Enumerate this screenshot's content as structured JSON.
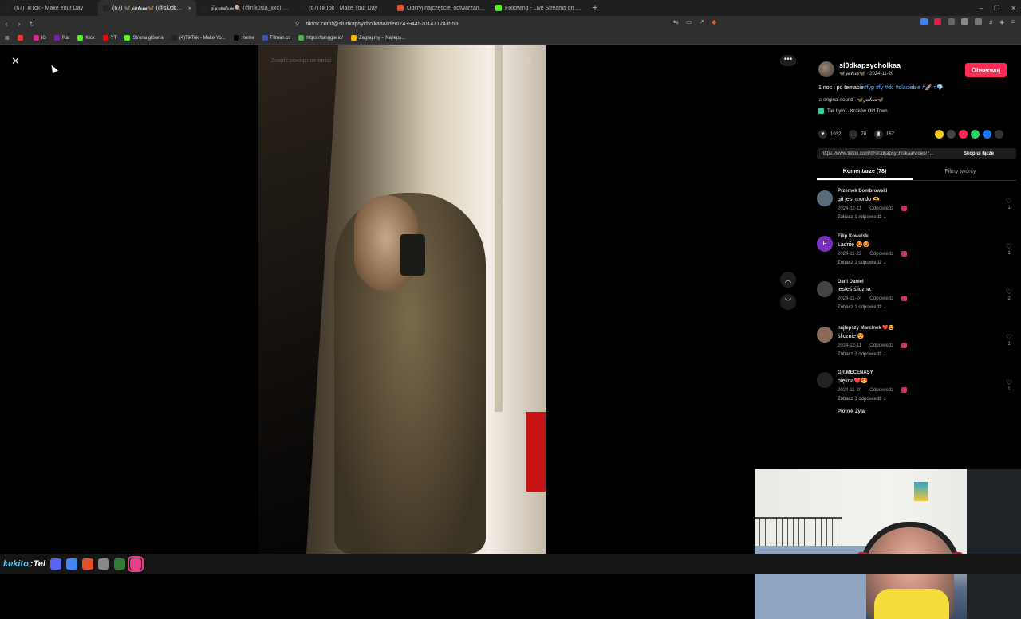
{
  "browser": {
    "tabs": [
      {
        "title": "(67)TikTok - Make Your Day",
        "favicon_color": "#222222",
        "active": false
      },
      {
        "title": "(67) 🦋𝓳𝓾𝓵𝓬𝓲𝓪🦋 (@sl0dkapsy",
        "favicon_color": "#222222",
        "active": true
      },
      {
        "title": "𝓩𝓰𝓻𝓮𝓭𝓪𝓶🍭 (@nik0sia_xxx) | TikTok",
        "favicon_color": "#222222",
        "active": false
      },
      {
        "title": "(67)TikTok - Make Your Day",
        "favicon_color": "#222222",
        "active": false
      },
      {
        "title": "Odkryj najczęściej odtwarzane utwo",
        "favicon_color": "#e5533b",
        "active": false
      },
      {
        "title": "Following - Live Streams on Kick",
        "favicon_color": "#53fc18",
        "active": false
      }
    ],
    "tab_close": "×",
    "new_tab": "+",
    "window_controls": [
      "–",
      "❐",
      "✕"
    ],
    "url": "tiktok.com/@sl0dkapsycholkaa/video/7439445701471243553",
    "bookmarks": [
      {
        "label": "",
        "color": "#e53935"
      },
      {
        "label": "IG",
        "color": "#d6249f"
      },
      {
        "label": "Rat",
        "color": "#7b1fa2"
      },
      {
        "label": "Kick",
        "color": "#53fc18"
      },
      {
        "label": "YT",
        "color": "#ff0000"
      },
      {
        "label": "Strona główna",
        "color": "#53fc18"
      },
      {
        "label": "(4)TikTok - Make Yo...",
        "color": "#222222"
      },
      {
        "label": "Home",
        "color": "#000000"
      },
      {
        "label": "Filman.cc",
        "color": "#3f51b5"
      },
      {
        "label": "https://tanggle.io/",
        "color": "#4caf50"
      },
      {
        "label": "Zagraj.my – Najleps...",
        "color": "#ffb300"
      }
    ]
  },
  "video": {
    "search_placeholder": "Znajdź powiązane treści",
    "close_symbol": "✕",
    "more_symbol": "•••",
    "nav_up": "︿",
    "nav_down": "﹀"
  },
  "panel": {
    "author_name": "sl0dkapsycholkaa",
    "author_sub": "🦋𝓳𝓾𝓵𝓬𝓲𝓪🦋 · 2024-11-20",
    "follow_label": "Obserwuj",
    "description": "1 noc i po temacie",
    "tags": "#fyp #fy #dc #dlaciebie #🚀 #💎",
    "sound": "♫ original sound - 🦋𝓳𝓾𝓵𝓬𝓲𝓪🦋",
    "location": "Tak było. · Kraków Old Town",
    "likes": "1032",
    "comments_count": "78",
    "saves": "157",
    "share_colors": [
      "#f5c518",
      "#444444",
      "#fe2c55",
      "#25d366",
      "#1877f2",
      "#333333"
    ],
    "link": "https://www.tiktok.com/@sl0dkapsycholkaa/video/7...",
    "copy_label": "Skopiuj łącze",
    "tab_comments": "Komentarze (78)",
    "tab_creator": "Filmy twórcy",
    "comments": [
      {
        "user": "Przemek Dombrowski",
        "text": "git jest mordo 🫶",
        "date": "2024-12-11",
        "reply": "Odpowiedz",
        "more": "Zobacz 1 odpowiedź ⌄",
        "likes": "1",
        "avatar_color": "#5b6b7b",
        "avatar_letter": ""
      },
      {
        "user": "Filip Kowalski",
        "text": "Ładnie 😍😍",
        "date": "2024-11-22",
        "reply": "Odpowiedz",
        "more": "Zobacz 1 odpowiedź ⌄",
        "likes": "1",
        "avatar_color": "#7b2fbf",
        "avatar_letter": "F"
      },
      {
        "user": "Dani Daniel",
        "text": "jesteś śliczna",
        "date": "2024-11-24",
        "reply": "Odpowiedz",
        "more": "Zobacz 1 odpowiedź ⌄",
        "likes": "2",
        "avatar_color": "#444444",
        "avatar_letter": ""
      },
      {
        "user": "najlepszy Marcinek ❤️😍",
        "text": "ślicznie 😍",
        "date": "2024-12-11",
        "reply": "Odpowiedz",
        "more": "Zobacz 1 odpowiedź ⌄",
        "likes": "1",
        "avatar_color": "#8a6a5a",
        "avatar_letter": ""
      },
      {
        "user": "GR.MECENASY",
        "text": "piękna❤️😍",
        "date": "2024-11-20",
        "reply": "Odpowiedz",
        "more": "Zobacz 1 odpowiedź ⌄",
        "likes": "1",
        "avatar_color": "#222222",
        "avatar_letter": ""
      }
    ],
    "partial_comment_user": "Piotrek Żyła"
  },
  "taskbar": {
    "brand_a": "kekito",
    "brand_b": ":Tel",
    "icons": [
      "#5865f2",
      "#4285f4",
      "#e34f26",
      "#888888",
      "#2e7d32",
      "#e83e8c"
    ]
  }
}
